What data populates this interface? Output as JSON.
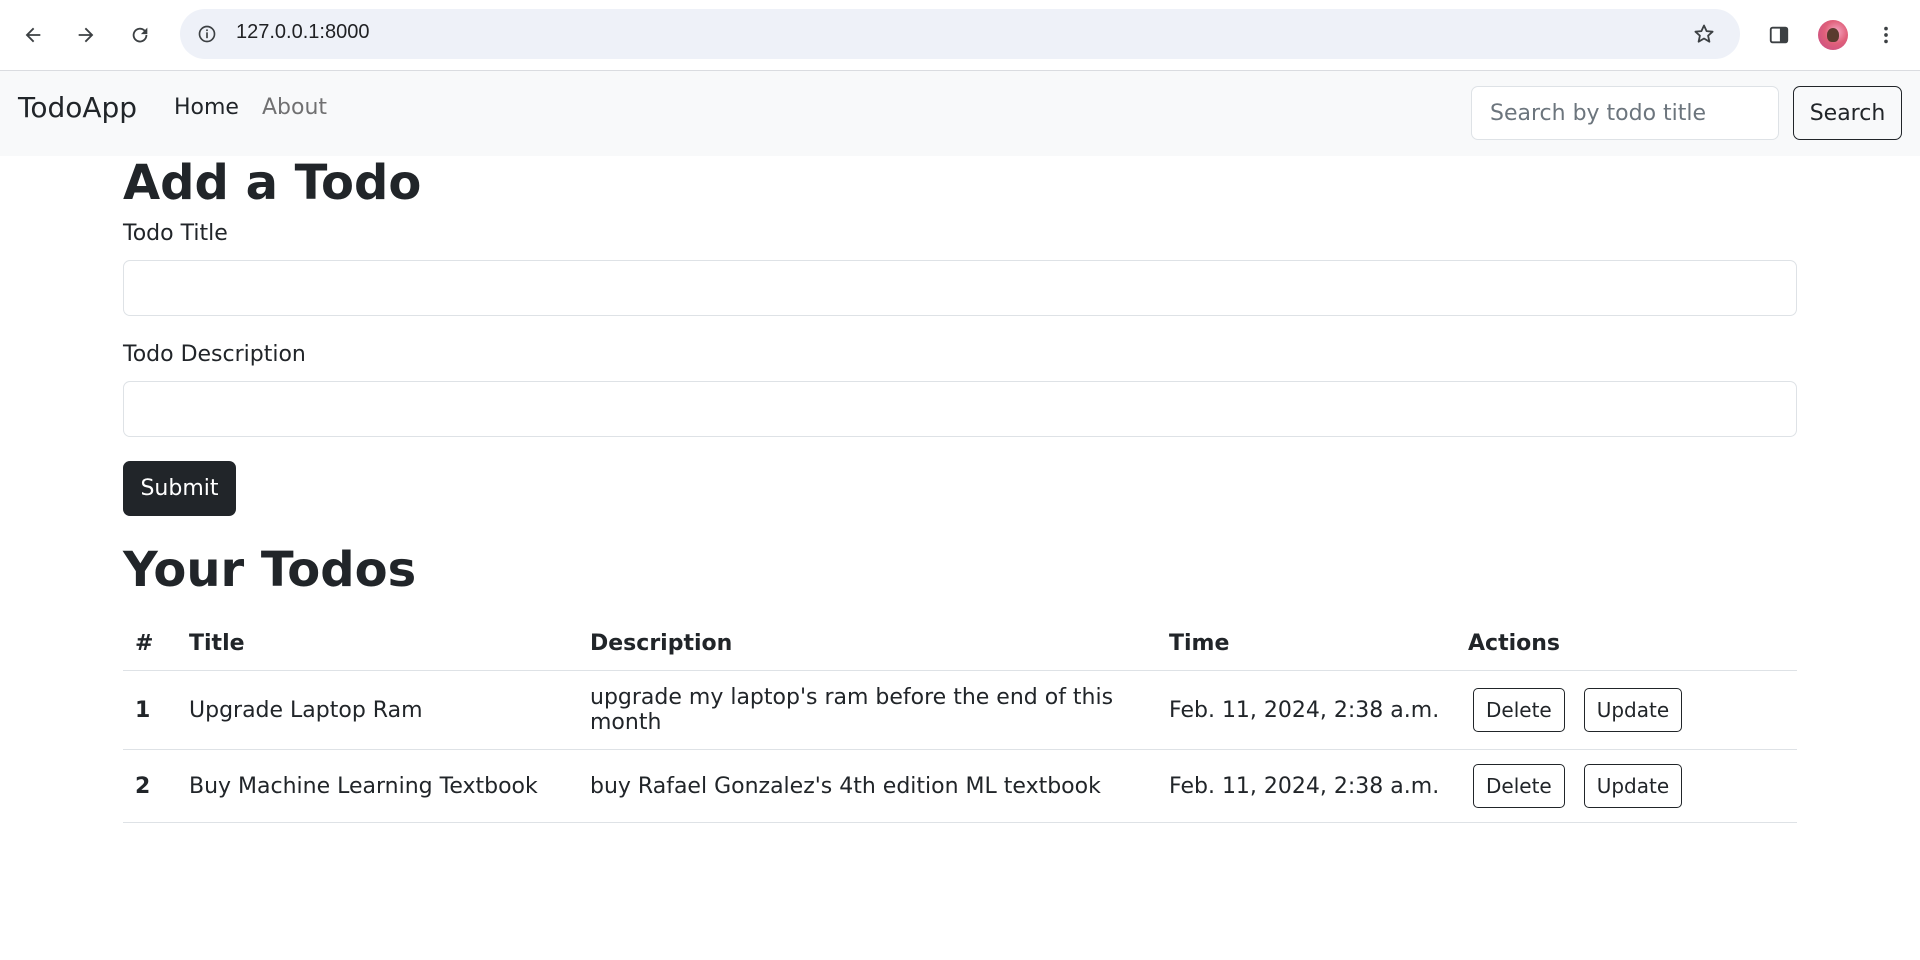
{
  "browser": {
    "url": "127.0.0.1:8000",
    "icons": [
      "back-arrow-icon",
      "forward-arrow-icon",
      "reload-icon",
      "site-info-icon",
      "bookmark-star-icon",
      "side-panel-icon",
      "profile-avatar",
      "more-menu-icon"
    ]
  },
  "navbar": {
    "brand": "TodoApp",
    "links": [
      "Home",
      "About"
    ],
    "search_placeholder": "Search by todo title",
    "search_button": "Search"
  },
  "form": {
    "heading": "Add a Todo",
    "title_label": "Todo Title",
    "title_value": "",
    "description_label": "Todo Description",
    "description_value": "",
    "submit_label": "Submit"
  },
  "todos": {
    "heading": "Your Todos",
    "columns": [
      "#",
      "Title",
      "Description",
      "Time",
      "Actions"
    ],
    "rows": [
      {
        "num": "1",
        "title": "Upgrade Laptop Ram",
        "description": "upgrade my laptop's ram before the end of this month",
        "time": "Feb. 11, 2024, 2:38 a.m.",
        "delete": "Delete",
        "update": "Update"
      },
      {
        "num": "2",
        "title": "Buy Machine Learning Textbook",
        "description": "buy Rafael Gonzalez's 4th edition ML textbook",
        "time": "Feb. 11, 2024, 2:38 a.m.",
        "delete": "Delete",
        "update": "Update"
      }
    ]
  }
}
